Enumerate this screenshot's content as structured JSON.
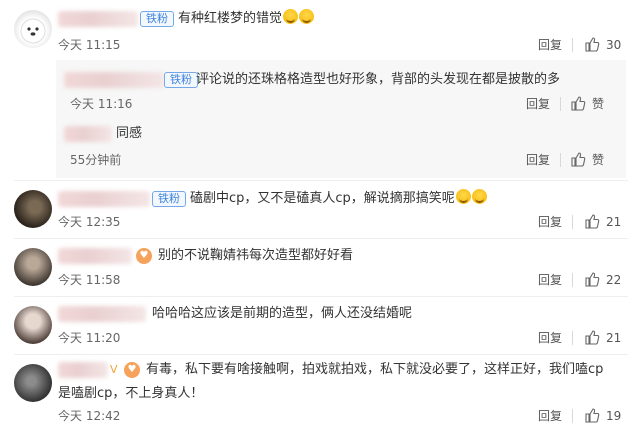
{
  "comments": [
    {
      "badge": "铁粉",
      "text": "有种红楼梦的错觉",
      "time": "今天 11:15",
      "reply": "回复",
      "likes": "30",
      "replies": [
        {
          "badge": "铁粉",
          "text": "评论说的还珠格格造型也好形象，背部的头发现在都是披散的多",
          "time": "今天 11:16",
          "reply": "回复",
          "likes": "赞"
        },
        {
          "text": "同感",
          "time": "55分钟前",
          "reply": "回复",
          "likes": "赞"
        }
      ]
    },
    {
      "badge": "铁粉",
      "text": "磕剧中cp，又不是磕真人cp，解说摘那搞笑呢",
      "time": "今天 12:35",
      "reply": "回复",
      "likes": "21"
    },
    {
      "text": "别的不说鞠婧祎每次造型都好好看",
      "time": "今天 11:58",
      "reply": "回复",
      "likes": "22"
    },
    {
      "text": "哈哈哈这应该是前期的造型，俩人还没结婚呢",
      "time": "今天 11:20",
      "reply": "回复",
      "likes": "21"
    },
    {
      "text_line1": "有毒，私下要有啥接触啊，拍戏就拍戏，私下就没必要了，这样正好，我们嗑cp",
      "text_line2": "是嗑剧cp，不上身真人！",
      "time": "今天 12:42",
      "reply": "回复",
      "likes": "19"
    }
  ],
  "icons": {
    "like": "thumbs-up-icon",
    "heart_badge": "heart-badge-icon",
    "emoji": "laughing-emoji-icon"
  }
}
